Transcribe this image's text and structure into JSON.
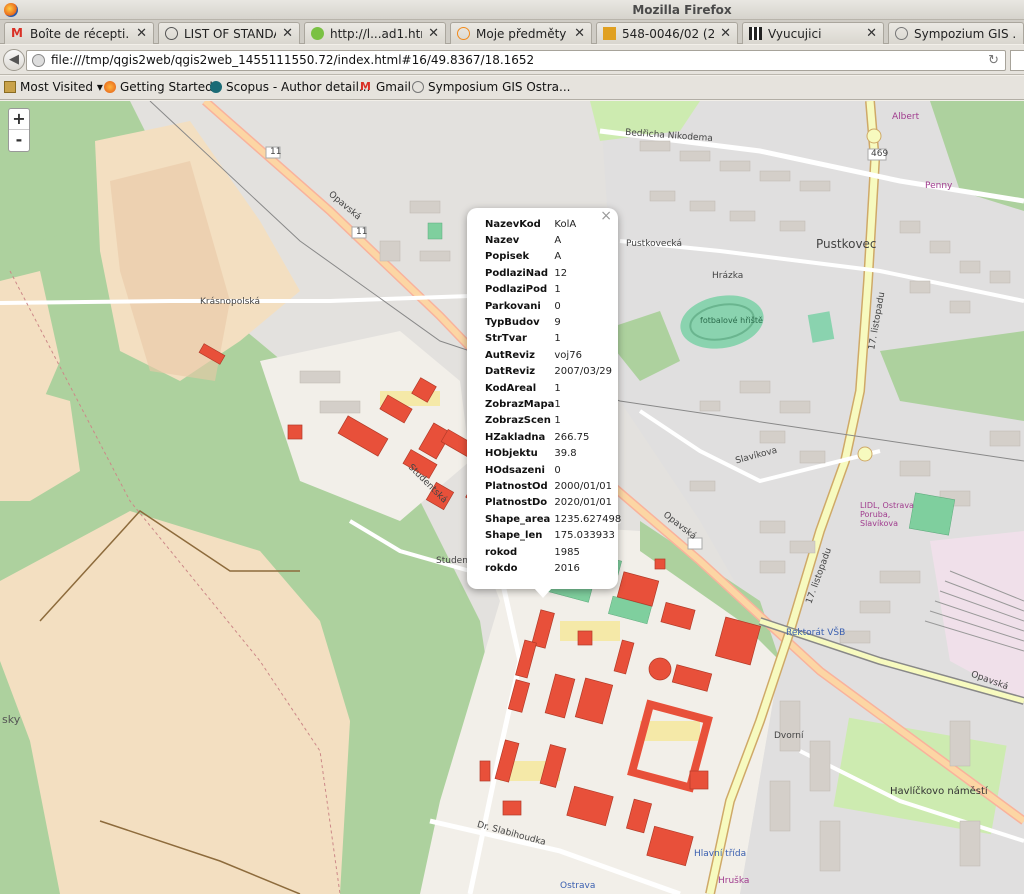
{
  "window": {
    "title": "Mozilla Firefox"
  },
  "tabs": [
    {
      "label": "Boîte de récepti...",
      "icon": "gmail-icon"
    },
    {
      "label": "LIST OF STANDA...",
      "icon": "wordpress-icon"
    },
    {
      "label": "http://l...ad1.html",
      "icon": "globe-icon"
    },
    {
      "label": "Moje předměty",
      "icon": "moodle-icon"
    },
    {
      "label": "548-0046/02 (20...",
      "icon": "university-icon"
    },
    {
      "label": "Vyucujici",
      "icon": "grid-icon"
    },
    {
      "label": "Sympozium GIS ...",
      "icon": "globe-icon"
    }
  ],
  "navbar": {
    "url": "file:///tmp/qgis2web/qgis2web_1455111550.72/index.html#16/49.8367/18.1652"
  },
  "bookmarks": [
    {
      "label": "Most Visited ▾",
      "icon": "folder-icon"
    },
    {
      "label": "Getting Started",
      "icon": "firefox-icon"
    },
    {
      "label": "Scopus - Author detail...",
      "icon": "scopus-icon"
    },
    {
      "label": "Gmail",
      "icon": "gmail-icon"
    },
    {
      "label": "Symposium GIS Ostra...",
      "icon": "globe-icon"
    }
  ],
  "map": {
    "zoom_in": "+",
    "zoom_out": "-",
    "labels": {
      "opavska1": "Opavská",
      "opavska2": "Opavská",
      "opavska3": "Opavská",
      "krasnopolska": "Krásnopolská",
      "studentska1": "Studentská",
      "studentska2": "Studentská",
      "studentska3": "Studentská",
      "pustkovec": "Pustkovec",
      "hrazka": "Hrázka",
      "fotbal": "fotbalové hřiště",
      "listopadu1": "17. listopadu",
      "listopadu2": "17. listopadu",
      "havlickovo": "Havlíčkovo náměstí",
      "dvorni": "Dvorní",
      "slavikova": "Slavíkova",
      "rektorat": "Rektorát VŠB",
      "hlavni": "Hlavní třída",
      "sla": "Dr. Slabihoudka",
      "penny": "Penny",
      "albert": "Albert",
      "lidl": "LIDL, Ostrava Poruba, Slavíkova",
      "bedricha": "Bedřicha Nikodema",
      "pustkovecka": "Pustkovecká",
      "num11a": "11",
      "num11b": "11",
      "num469": "469",
      "sky": "sky",
      "hruska": "Hruška",
      "ostrava": "Ostrava"
    }
  },
  "popup": {
    "close": "×",
    "rows": [
      {
        "k": "NazevKod",
        "v": "KolA"
      },
      {
        "k": "Nazev",
        "v": "A"
      },
      {
        "k": "Popisek",
        "v": "A"
      },
      {
        "k": "PodlaziNad",
        "v": "12"
      },
      {
        "k": "PodlaziPod",
        "v": "1"
      },
      {
        "k": "Parkovani",
        "v": "0"
      },
      {
        "k": "TypBudov",
        "v": "9"
      },
      {
        "k": "StrTvar",
        "v": "1"
      },
      {
        "k": "AutReviz",
        "v": "voj76"
      },
      {
        "k": "DatReviz",
        "v": "2007/03/29"
      },
      {
        "k": "KodAreal",
        "v": "1"
      },
      {
        "k": "ZobrazMapa",
        "v": "1"
      },
      {
        "k": "ZobrazScen",
        "v": "1"
      },
      {
        "k": "HZakladna",
        "v": "266.75"
      },
      {
        "k": "HObjektu",
        "v": "39.8"
      },
      {
        "k": "HOdsazeni",
        "v": "0"
      },
      {
        "k": "PlatnostOd",
        "v": "2000/01/01"
      },
      {
        "k": "PlatnostDo",
        "v": "2020/01/01"
      },
      {
        "k": "Shape_area",
        "v": "1235.627498"
      },
      {
        "k": "Shape_len",
        "v": "175.033933"
      },
      {
        "k": "rokod",
        "v": "1985"
      },
      {
        "k": "rokdo",
        "v": "2016"
      }
    ]
  },
  "colors": {
    "forest": "#add19e",
    "farmland": "#f3dfc1",
    "residential": "#e0dfdf",
    "building_highlight": "#e8503a",
    "road_major": "#f9b29c",
    "road_secondary": "#f7fabf",
    "pitch": "#8ad3af"
  }
}
